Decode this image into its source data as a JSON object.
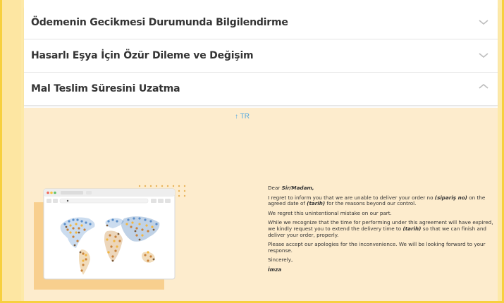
{
  "accordion": {
    "items": [
      {
        "title": "Ödemenin Gecikmesi Durumunda Bilgilendirme",
        "expanded": false
      },
      {
        "title": "Hasarlı Eşya İçin Özür Dileme ve Değişim",
        "expanded": false
      },
      {
        "title": "Mal Teslim Süresini Uzatma",
        "expanded": true
      }
    ]
  },
  "content": {
    "lang_link": "↑ TR",
    "letter": {
      "greeting_pre": "Dear ",
      "greeting_name": "Sir/Madam,",
      "p1_a": "I regret to inform you that we are unable to deliver your order no ",
      "p1_b": "(sipariş no)",
      "p1_c": " on the agreed date of ",
      "p1_d": "(tarih)",
      "p1_e": " for the reasons beyond our control.",
      "p2": "We regret this unintentional mistake on our part.",
      "p3_a": "While we recognize that the time for performing under this agreement will have expired, we kindly request you to extend the delivery time to ",
      "p3_b": "(tarih)",
      "p3_c": " so that we can finish and deliver your order, properly.",
      "p4": "Please accept our apologies for the inconvenience. We will be looking forward to your response.",
      "closing": "Sincerely,",
      "signature": "İmza"
    }
  },
  "colors": {
    "page_bg": "#fde9a8",
    "frame_border": "#f7d03f",
    "content_bg": "#fdeccd",
    "link": "#52a8e0",
    "shadow_block": "#f8cf8e"
  },
  "icons": [
    "chevron-down-icon",
    "chevron-up-icon",
    "world-map-illustration"
  ]
}
